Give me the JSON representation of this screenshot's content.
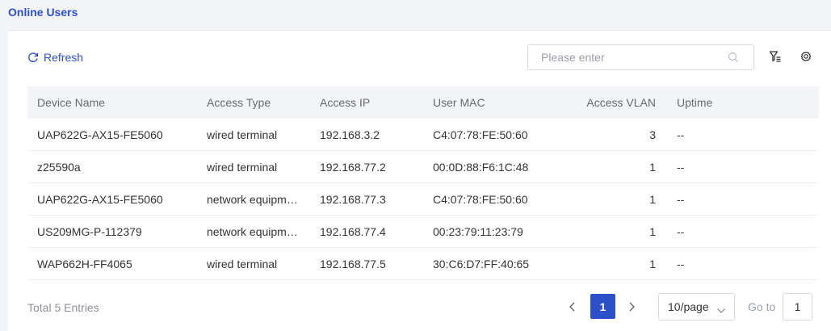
{
  "page": {
    "title": "Online Users"
  },
  "toolbar": {
    "refresh_label": "Refresh",
    "search_placeholder": "Please enter",
    "search_value": ""
  },
  "table": {
    "columns": [
      "Device Name",
      "Access Type",
      "Access IP",
      "User MAC",
      "Access VLAN",
      "Uptime"
    ],
    "rows": [
      [
        "UAP622G-AX15-FE5060",
        "wired terminal",
        "192.168.3.2",
        "C4:07:78:FE:50:60",
        "3",
        "--"
      ],
      [
        "z25590a",
        "wired terminal",
        "192.168.77.2",
        "00:0D:88:F6:1C:48",
        "1",
        "--"
      ],
      [
        "UAP622G-AX15-FE5060",
        "network equipm…",
        "192.168.77.3",
        "C4:07:78:FE:50:60",
        "1",
        "--"
      ],
      [
        "US209MG-P-112379",
        "network equipm…",
        "192.168.77.4",
        "00:23:79:11:23:79",
        "1",
        "--"
      ],
      [
        "WAP662H-FF4065",
        "wired terminal",
        "192.168.77.5",
        "30:C6:D7:FF:40:65",
        "1",
        "--"
      ]
    ]
  },
  "pagination": {
    "total_label": "Total 5  Entries",
    "current_page": "1",
    "page_size": "10/page",
    "goto_label": "Go to",
    "goto_value": "1"
  },
  "colors": {
    "accent": "#2b50c8",
    "header_bg": "#f3f4f7"
  },
  "icons": [
    "refresh-icon",
    "search-icon",
    "filter-icon",
    "gear-icon",
    "chevron-left-icon",
    "chevron-right-icon",
    "chevron-down-icon"
  ]
}
